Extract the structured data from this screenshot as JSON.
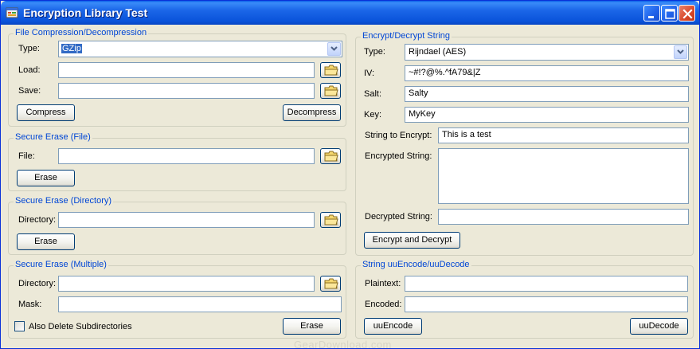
{
  "window": {
    "title": "Encryption Library Test"
  },
  "compression": {
    "group_label": "File Compression/Decompression",
    "type_label": "Type:",
    "type_value": "GZip",
    "load_label": "Load:",
    "load_value": "",
    "save_label": "Save:",
    "save_value": "",
    "compress_label": "Compress",
    "decompress_label": "Decompress"
  },
  "erase_file": {
    "group_label": "Secure Erase (File)",
    "file_label": "File:",
    "file_value": "",
    "erase_label": "Erase"
  },
  "erase_dir": {
    "group_label": "Secure Erase (Directory)",
    "dir_label": "Directory:",
    "dir_value": "",
    "erase_label": "Erase"
  },
  "erase_multi": {
    "group_label": "Secure Erase (Multiple)",
    "dir_label": "Directory:",
    "dir_value": "",
    "mask_label": "Mask:",
    "mask_value": "",
    "subdirs_label": "Also Delete Subdirectories",
    "subdirs_checked": false,
    "erase_label": "Erase"
  },
  "encrypt": {
    "group_label": "Encrypt/Decrypt String",
    "type_label": "Type:",
    "type_value": "Rijndael (AES)",
    "iv_label": "IV:",
    "iv_value": "~#!?@%.^fA79&|Z",
    "salt_label": "Salt:",
    "salt_value": "Salty",
    "key_label": "Key:",
    "key_value": "MyKey",
    "to_encrypt_label": "String to Encrypt:",
    "to_encrypt_value": "This is a test",
    "encrypted_label": "Encrypted String:",
    "encrypted_value": "",
    "decrypted_label": "Decrypted String:",
    "decrypted_value": "",
    "button_label": "Encrypt and Decrypt"
  },
  "uuencode": {
    "group_label": "String uuEncode/uuDecode",
    "plaintext_label": "Plaintext:",
    "plaintext_value": "",
    "encoded_label": "Encoded:",
    "encoded_value": "",
    "encode_label": "uuEncode",
    "decode_label": "uuDecode"
  },
  "watermark": "GearDownload.com",
  "colors": {
    "title_bar": "#0A53DA",
    "group_label": "#0046D5",
    "window_bg": "#ECE9D8",
    "selection": "#316AC5"
  },
  "icons": {
    "app": "app-icon",
    "minimize": "minimize-icon",
    "maximize": "maximize-icon",
    "close": "close-icon",
    "browse": "folder-icon",
    "dropdown": "chevron-down-icon"
  }
}
